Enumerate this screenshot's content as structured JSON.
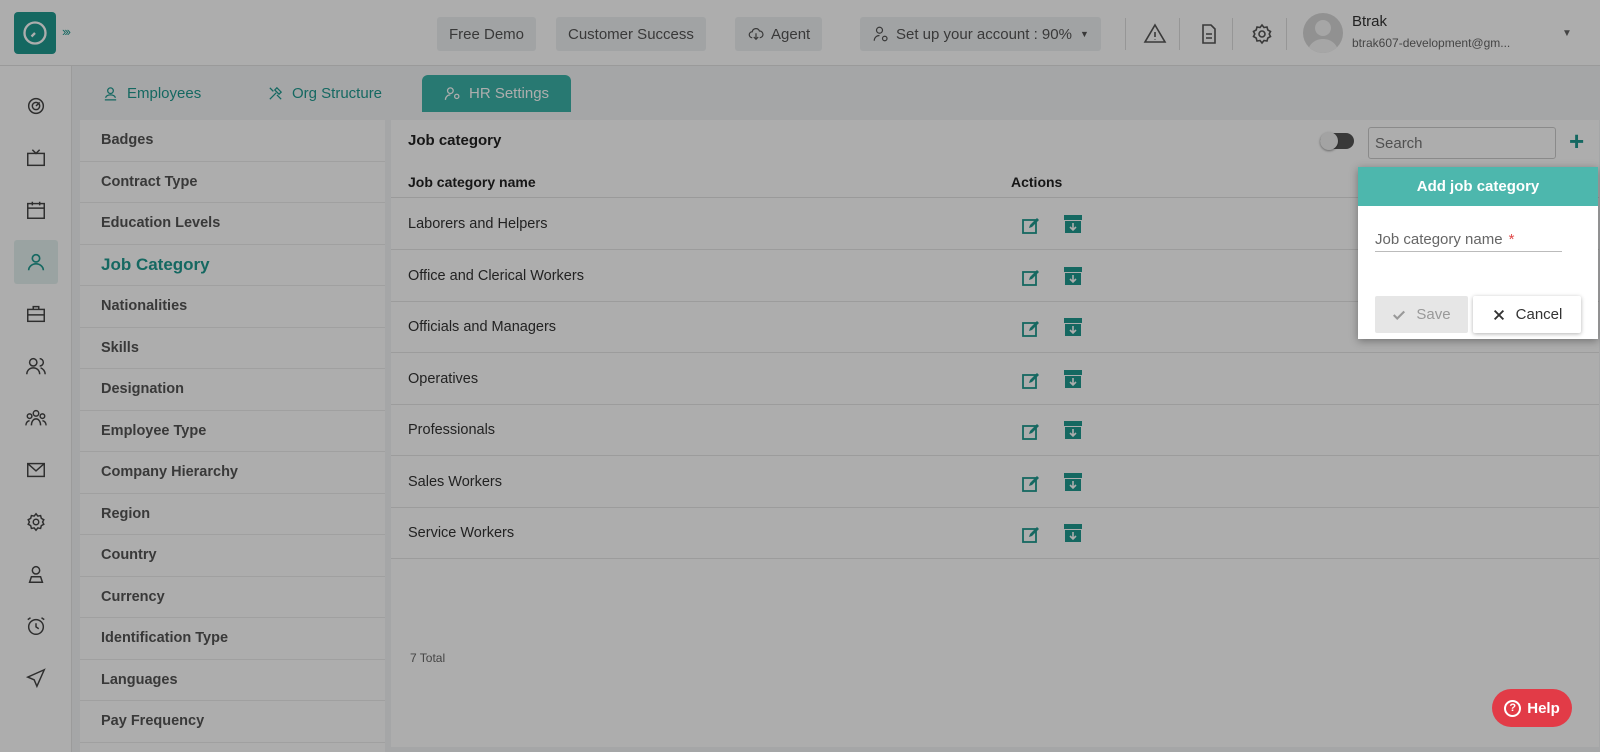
{
  "topbar": {
    "free_demo": "Free Demo",
    "customer_success": "Customer Success",
    "agent": "Agent",
    "setup_account": "Set up your account : 90%",
    "user_name": "Btrak",
    "user_email": "btrak607-development@gm..."
  },
  "rail": {
    "icons": [
      "dashboard-icon",
      "tv-icon",
      "calendar-icon",
      "user-icon",
      "briefcase-icon",
      "users-icon",
      "team-icon",
      "mail-icon",
      "settings-icon",
      "profile-icon",
      "alarm-icon",
      "send-icon"
    ],
    "active_index": 3
  },
  "module_tabs": [
    {
      "label": "Employees",
      "icon": "user-icon"
    },
    {
      "label": "Org Structure",
      "icon": "tools-icon"
    },
    {
      "label": "HR Settings",
      "icon": "user-settings-icon",
      "active": true
    }
  ],
  "settings_list": {
    "items": [
      "Badges",
      "Contract Type",
      "Education Levels",
      "Job Category",
      "Nationalities",
      "Skills",
      "Designation",
      "Employee Type",
      "Company Hierarchy",
      "Region",
      "Country",
      "Currency",
      "Identification Type",
      "Languages",
      "Pay Frequency"
    ],
    "active": "Job Category"
  },
  "panel": {
    "title": "Job category",
    "search_placeholder": "Search",
    "add_symbol": "+",
    "col_name": "Job category name",
    "col_actions": "Actions",
    "rows": [
      "Laborers and Helpers",
      "Office and Clerical Workers",
      "Officials and Managers",
      "Operatives",
      "Professionals",
      "Sales Workers",
      "Service Workers"
    ],
    "total": "7 Total"
  },
  "popup": {
    "title": "Add job category",
    "field_label": "Job category name",
    "required_mark": "*",
    "save": "Save",
    "cancel": "Cancel"
  },
  "help": {
    "label": "Help",
    "symbol": "?"
  },
  "colors": {
    "accent": "#1f9a90",
    "header": "#4db7ad",
    "help": "#e23b47"
  }
}
